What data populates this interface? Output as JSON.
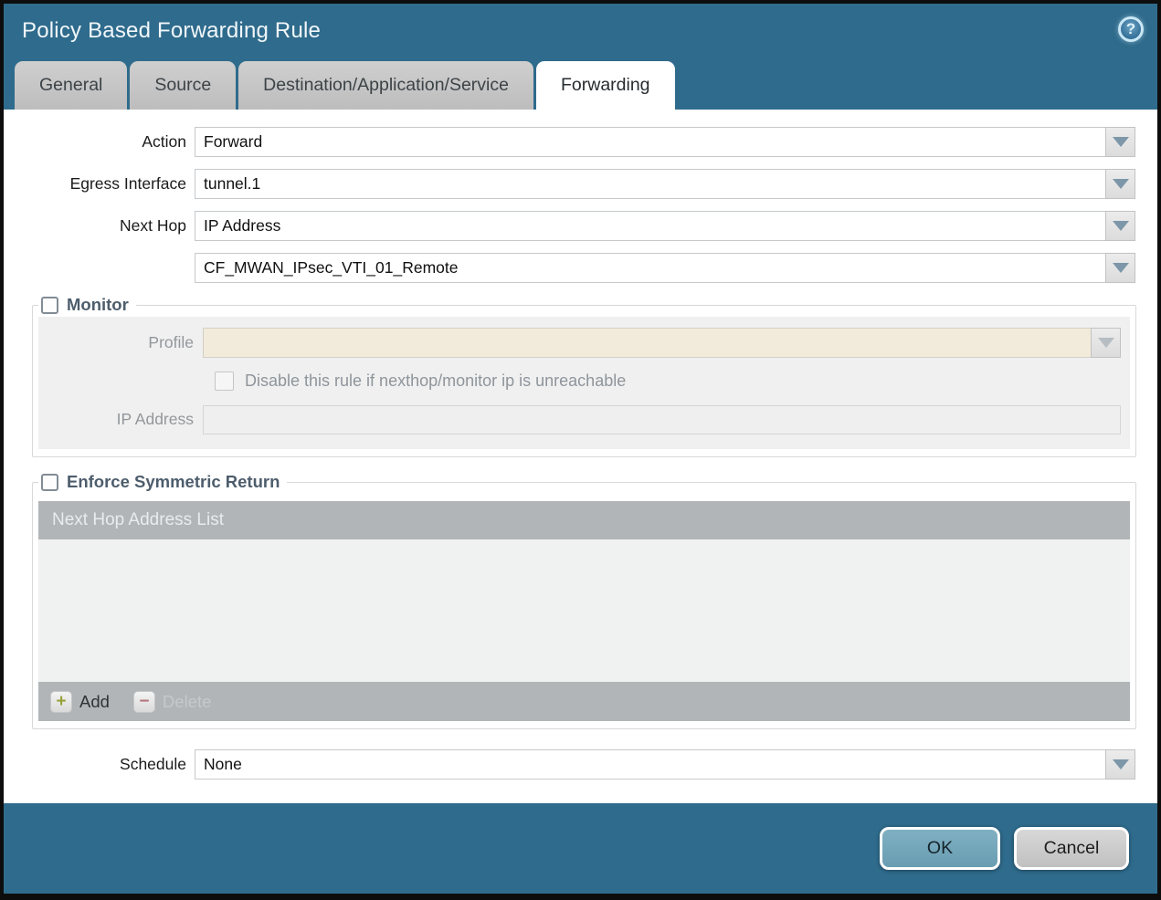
{
  "window": {
    "title": "Policy Based Forwarding Rule"
  },
  "icons": {
    "help": "?",
    "add_plus": "+",
    "delete_minus": "−"
  },
  "tabs": [
    {
      "label": "General",
      "active": false
    },
    {
      "label": "Source",
      "active": false
    },
    {
      "label": "Destination/Application/Service",
      "active": false
    },
    {
      "label": "Forwarding",
      "active": true
    }
  ],
  "form": {
    "action": {
      "label": "Action",
      "value": "Forward"
    },
    "egress_interface": {
      "label": "Egress Interface",
      "value": "tunnel.1"
    },
    "next_hop": {
      "label": "Next Hop",
      "value": "IP Address"
    },
    "next_hop_address": {
      "value": "CF_MWAN_IPsec_VTI_01_Remote"
    },
    "schedule": {
      "label": "Schedule",
      "value": "None"
    }
  },
  "monitor": {
    "label": "Monitor",
    "checked": false,
    "profile": {
      "label": "Profile",
      "value": ""
    },
    "disable_rule": {
      "label": "Disable this rule if nexthop/monitor ip is unreachable",
      "checked": false
    },
    "ip_address": {
      "label": "IP Address",
      "value": ""
    }
  },
  "enforce_symmetric_return": {
    "label": "Enforce Symmetric Return",
    "checked": false,
    "table": {
      "header": "Next Hop Address List",
      "rows": []
    },
    "add_label": "Add",
    "delete_label": "Delete"
  },
  "footer": {
    "ok_label": "OK",
    "cancel_label": "Cancel"
  },
  "colors": {
    "titlebar_teal": "#2f6b8c",
    "ok_button": "#76a8bc",
    "profile_disabled_bg": "#f2ebdb",
    "table_bar_gray": "#b2b5b8",
    "tab_inactive_gray": "#c4c4c4"
  }
}
